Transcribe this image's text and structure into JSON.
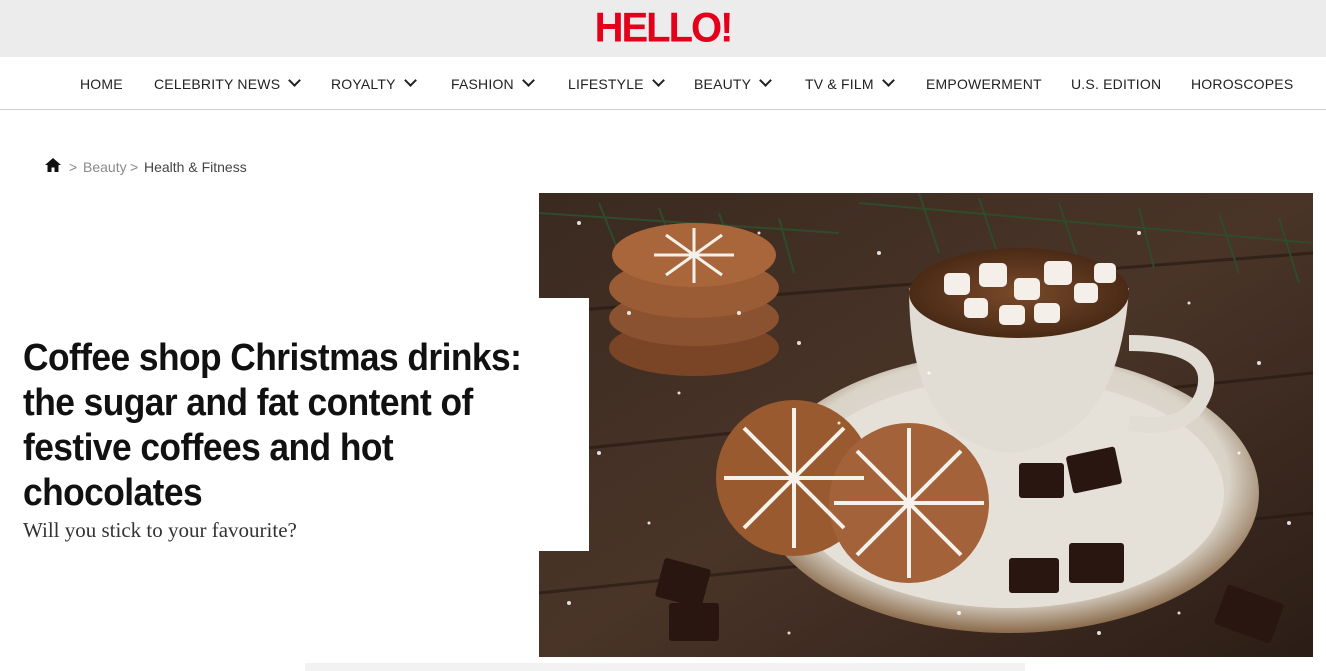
{
  "brand": {
    "logo_text": "HELLO!",
    "brand_color": "#e2001a"
  },
  "nav": {
    "items": [
      {
        "label": "HOME",
        "has_dropdown": false
      },
      {
        "label": "CELEBRITY NEWS",
        "has_dropdown": true
      },
      {
        "label": "ROYALTY",
        "has_dropdown": true
      },
      {
        "label": "FASHION",
        "has_dropdown": true
      },
      {
        "label": "LIFESTYLE",
        "has_dropdown": true
      },
      {
        "label": "BEAUTY",
        "has_dropdown": true
      },
      {
        "label": "TV & FILM",
        "has_dropdown": true
      },
      {
        "label": "EMPOWERMENT",
        "has_dropdown": false
      },
      {
        "label": "U.S. EDITION",
        "has_dropdown": false
      },
      {
        "label": "HOROSCOPES",
        "has_dropdown": false
      }
    ]
  },
  "breadcrumb": {
    "home_icon": "home-icon",
    "separator": ">",
    "items": [
      "Beauty",
      "Health & Fitness"
    ]
  },
  "article": {
    "headline": "Coffee shop Christmas drinks: the sugar and fat content of festive coffees and hot chocolates",
    "subtitle": "Will you stick to your favourite?"
  }
}
